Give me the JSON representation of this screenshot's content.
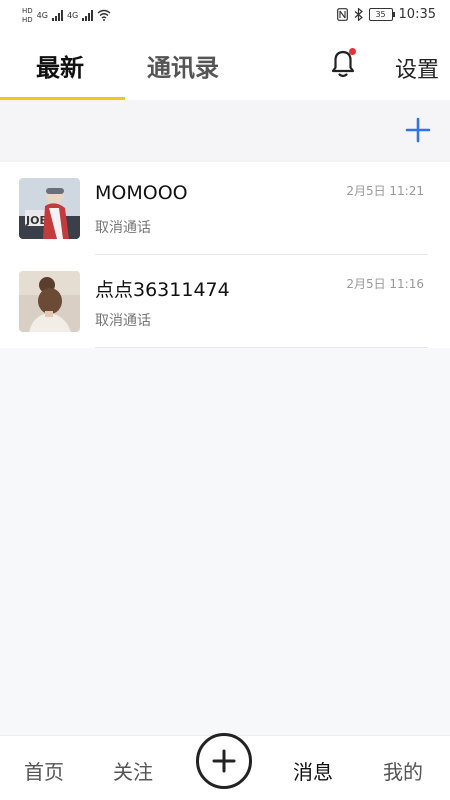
{
  "status_bar": {
    "time": "10:35",
    "battery": "35",
    "network_left": "4G",
    "network_right": "4G",
    "hd_top": "HD",
    "hd_bottom": "HD"
  },
  "header": {
    "tabs": [
      {
        "label": "最新",
        "active": true
      },
      {
        "label": "通讯录",
        "active": false
      }
    ],
    "notification_icon": "bell-icon",
    "settings_label": "设置",
    "accent_color": "#f5c518",
    "badge_color": "#e8303a"
  },
  "toolbar": {
    "add_icon": "plus-icon",
    "add_color": "#2f73e8"
  },
  "conversations": [
    {
      "name": "MOMOOO",
      "subtitle": "取消通话",
      "time": "2月5日 11:21",
      "avatar": "avatar-ski"
    },
    {
      "name": "点点36311474",
      "subtitle": "取消通话",
      "time": "2月5日 11:16",
      "avatar": "avatar-hair"
    }
  ],
  "bottom_nav": {
    "items": [
      {
        "label": "首页"
      },
      {
        "label": "关注"
      },
      {
        "label": "消息",
        "active": true
      },
      {
        "label": "我的"
      }
    ],
    "center_icon": "plus-circle-icon"
  }
}
